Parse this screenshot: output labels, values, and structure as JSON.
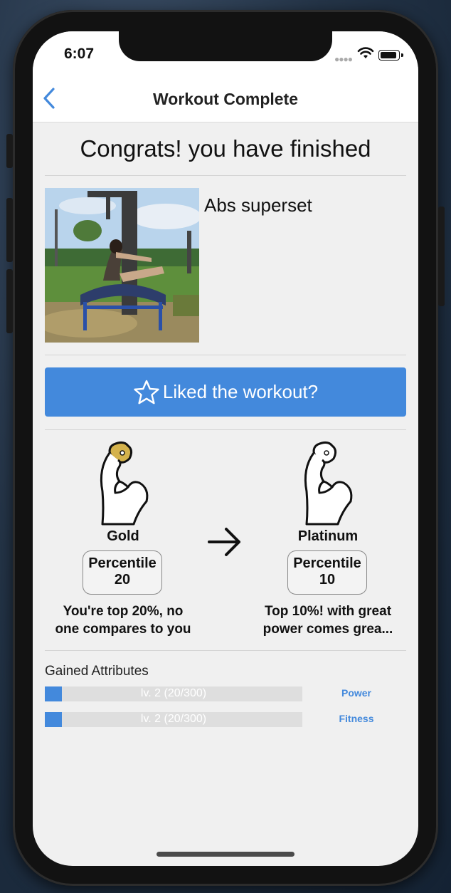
{
  "status_bar": {
    "time": "6:07"
  },
  "navbar": {
    "title": "Workout Complete"
  },
  "congrats_text": "Congrats! you have finished",
  "workout": {
    "name": "Abs superset"
  },
  "like_button": {
    "label": "Liked the workout?",
    "icon": "star-outline-icon"
  },
  "rank_current": {
    "name": "Gold",
    "percentile_label": "Percentile",
    "percentile_value": "20",
    "desc_line1": "You're top 20%, no",
    "desc_line2": "one compares to you",
    "badge_color": "#d4b24c"
  },
  "rank_next": {
    "name": "Platinum",
    "percentile_label": "Percentile",
    "percentile_value": "10",
    "desc_line1": "Top 10%! with great",
    "desc_line2": "power comes grea..."
  },
  "gained": {
    "title": "Gained Attributes",
    "attributes": [
      {
        "name": "Power",
        "bar_text": "lv. 2 (20/300)",
        "progress": 0.067
      },
      {
        "name": "Fitness",
        "bar_text": "lv. 2 (20/300)",
        "progress": 0.067
      }
    ]
  },
  "colors": {
    "accent": "#4389dc",
    "background": "#f0f0f0"
  }
}
